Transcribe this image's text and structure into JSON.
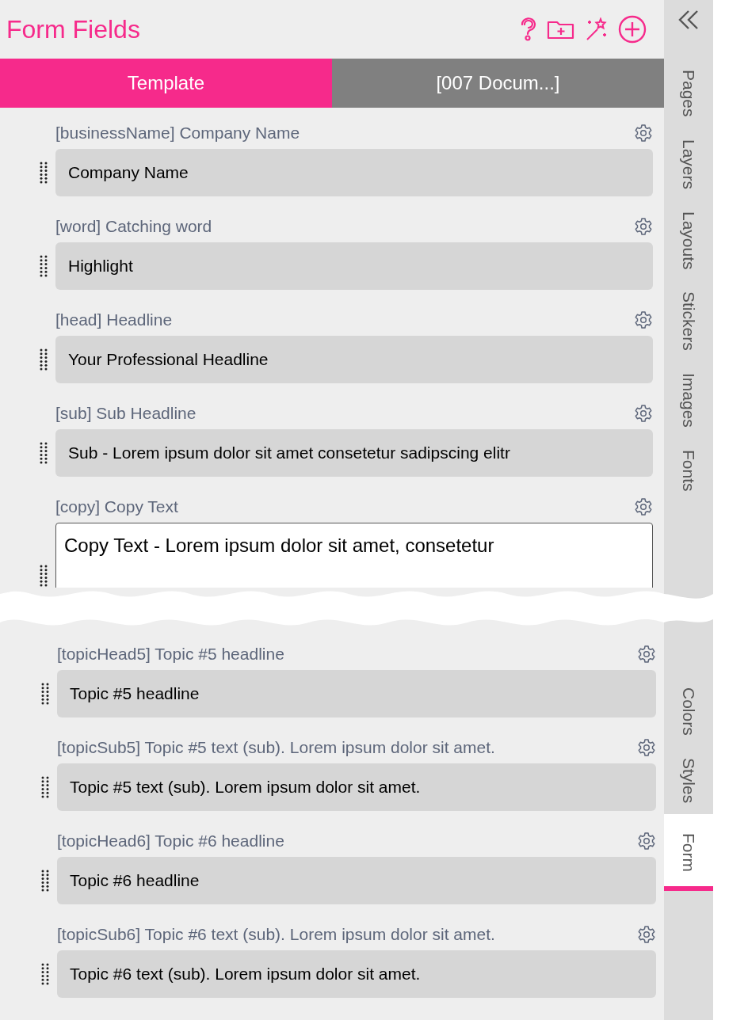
{
  "header": {
    "title": "Form Fields"
  },
  "tabs": [
    {
      "label": "Template",
      "selected": true
    },
    {
      "label": "[007 Docum...]",
      "selected": false
    }
  ],
  "fields_top": [
    {
      "label": "[businessName] Company Name",
      "value": "Company Name",
      "kind": "input"
    },
    {
      "label": "[word] Catching word",
      "value": "Highlight",
      "kind": "input"
    },
    {
      "label": "[head] Headline",
      "value": "Your Professional Headline",
      "kind": "input"
    },
    {
      "label": "[sub] Sub Headline",
      "value": "Sub - Lorem ipsum dolor sit amet consetetur sadipscing elitr",
      "kind": "input"
    },
    {
      "label": "[copy] Copy Text",
      "value": "Copy Text - Lorem ipsum dolor sit amet, consetetur",
      "kind": "textarea"
    }
  ],
  "fields_bottom": [
    {
      "label": "[topicHead5] Topic #5 headline",
      "value": "Topic #5 headline",
      "kind": "input"
    },
    {
      "label": "[topicSub5] Topic #5 text (sub). Lorem ipsum dolor sit amet.",
      "value": "Topic #5 text (sub). Lorem ipsum dolor sit amet.",
      "kind": "input"
    },
    {
      "label": "[topicHead6] Topic #6 headline",
      "value": "Topic #6 headline",
      "kind": "input"
    },
    {
      "label": "[topicSub6] Topic #6 text (sub). Lorem ipsum dolor sit amet.",
      "value": "Topic #6 text (sub). Lorem ipsum dolor sit amet.",
      "kind": "input"
    }
  ],
  "side_tabs_top": [
    {
      "label": "Pages",
      "selected": false
    },
    {
      "label": "Layers",
      "selected": false
    },
    {
      "label": "Layouts",
      "selected": false
    },
    {
      "label": "Stickers",
      "selected": false
    },
    {
      "label": "Images",
      "selected": false
    },
    {
      "label": "Fonts",
      "selected": false
    }
  ],
  "side_tabs_bottom": [
    {
      "label": "Colors",
      "selected": false
    },
    {
      "label": "Styles",
      "selected": false
    },
    {
      "label": "Form",
      "selected": true
    }
  ]
}
